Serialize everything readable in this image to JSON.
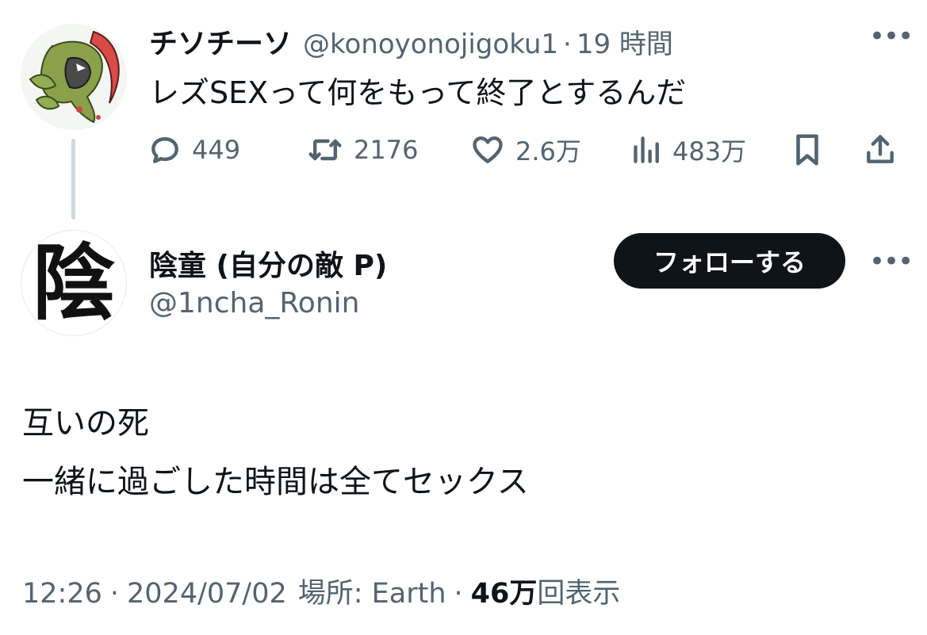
{
  "parent_tweet": {
    "display_name": "チソチーソ",
    "handle": "@konoyonojigoku1",
    "separator": "·",
    "time": "19 時間",
    "text": "レズSEXって何をもって終了とするんだ",
    "more_icon": "more-horizontal-icon",
    "actions": {
      "replies": "449",
      "retweets": "2176",
      "likes": "2.6万",
      "views": "483万"
    }
  },
  "main_tweet": {
    "avatar_glyph": "陰",
    "display_name": "陰童 (自分の敵 P)",
    "handle": "@1ncha_Ronin",
    "follow_label": "フォローする",
    "more_icon": "more-horizontal-icon",
    "text_lines": [
      "互いの死",
      "一緒に過ごした時間は全てセックス"
    ],
    "meta": {
      "time": "12:26",
      "sep1": "·",
      "date": "2024/07/02",
      "location": "場所: Earth",
      "sep2": "·",
      "views_count": "46万",
      "views_suffix": "回表示"
    }
  },
  "colors": {
    "text_primary": "#0f1419",
    "text_secondary": "#536471",
    "thread_line": "#cfd9de",
    "follow_button_bg": "#0f1419",
    "follow_button_text": "#ffffff"
  }
}
